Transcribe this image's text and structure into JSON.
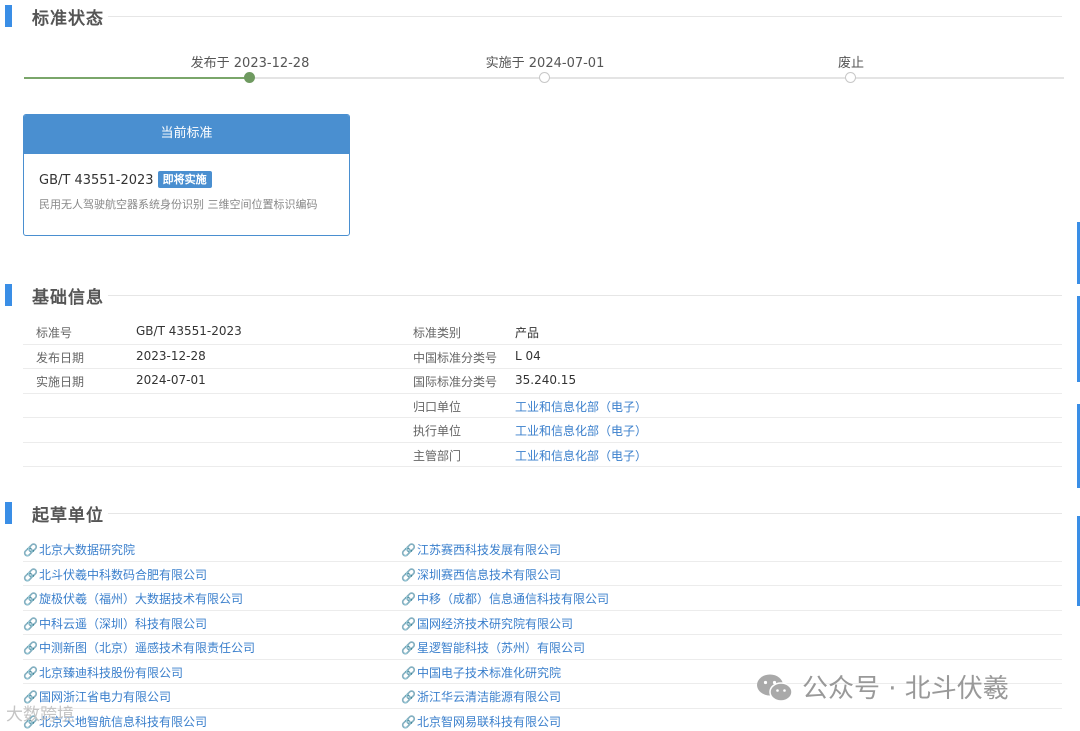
{
  "status_section": {
    "title": "标准状态"
  },
  "timeline": {
    "steps": [
      {
        "label": "发布于 2023-12-28",
        "state": "done"
      },
      {
        "label": "实施于 2024-07-01",
        "state": "pending"
      },
      {
        "label": "废止",
        "state": "pending"
      }
    ]
  },
  "current_card": {
    "header": "当前标准",
    "code": "GB/T 43551-2023",
    "badge": "即将实施",
    "description": "民用无人驾驶航空器系统身份识别 三维空间位置标识编码"
  },
  "basic_section": {
    "title": "基础信息"
  },
  "basic_info": [
    {
      "k1": "标准号",
      "v1": "GB/T 43551-2023",
      "k2": "标准类别",
      "v2": "产品",
      "v2_link": false
    },
    {
      "k1": "发布日期",
      "v1": "2023-12-28",
      "k2": "中国标准分类号",
      "v2": "L 04",
      "v2_link": false
    },
    {
      "k1": "实施日期",
      "v1": "2024-07-01",
      "k2": "国际标准分类号",
      "v2": "35.240.15",
      "v2_link": false
    },
    {
      "k1": "",
      "v1": "",
      "k2": "归口单位",
      "v2": "工业和信息化部（电子）",
      "v2_link": true
    },
    {
      "k1": "",
      "v1": "",
      "k2": "执行单位",
      "v2": "工业和信息化部（电子）",
      "v2_link": true
    },
    {
      "k1": "",
      "v1": "",
      "k2": "主管部门",
      "v2": "工业和信息化部（电子）",
      "v2_link": true
    }
  ],
  "draft_section": {
    "title": "起草单位"
  },
  "draft_units": [
    [
      "北京大数据研究院",
      "江苏赛西科技发展有限公司"
    ],
    [
      "北斗伏羲中科数码合肥有限公司",
      "深圳赛西信息技术有限公司"
    ],
    [
      "旋极伏羲（福州）大数据技术有限公司",
      "中移（成都）信息通信科技有限公司"
    ],
    [
      "中科云遥（深圳）科技有限公司",
      "国网经济技术研究院有限公司"
    ],
    [
      "中测新图（北京）遥感技术有限责任公司",
      "星逻智能科技（苏州）有限公司"
    ],
    [
      "北京臻迪科技股份有限公司",
      "中国电子技术标准化研究院"
    ],
    [
      "国网浙江省电力有限公司",
      "浙江华云清洁能源有限公司"
    ],
    [
      "北京天地智航信息科技有限公司",
      "北京智网易联科技有限公司"
    ]
  ],
  "watermark": {
    "text": "公众号 · 北斗伏羲",
    "secondary": "大数跨境"
  },
  "colors": {
    "accent": "#3a8ee6",
    "card": "#4a8fd0",
    "link": "#3a7fcc",
    "progress": "#6f9a60"
  }
}
